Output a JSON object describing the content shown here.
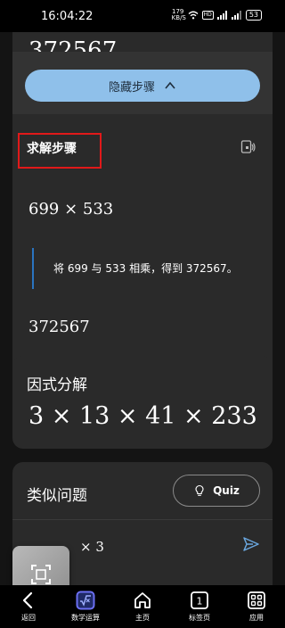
{
  "status_bar": {
    "time": "16:04:22",
    "net_speed_value": "179",
    "net_speed_unit": "KB/S",
    "hd_label": "HD",
    "battery": "53"
  },
  "result": {
    "value_top": "372567",
    "hide_steps_label": "隐藏步骤"
  },
  "steps": {
    "title": "求解步骤",
    "expression": "699 × 533",
    "explanation": "将 699 与 533 相乘，得到 372567。",
    "result": "372567"
  },
  "factor": {
    "title": "因式分解",
    "expression": "3 × 13 × 41 × 233"
  },
  "similar": {
    "title": "类似问题",
    "quiz_label": "Quiz",
    "problem_text": "× 3"
  },
  "nav": [
    {
      "label": "返回",
      "icon": "back-arrow-icon"
    },
    {
      "label": "数学运算",
      "icon": "math-solver-icon"
    },
    {
      "label": "主页",
      "icon": "home-icon"
    },
    {
      "label": "标签页",
      "icon": "tabs-icon",
      "count": "1"
    },
    {
      "label": "应用",
      "icon": "apps-grid-icon"
    }
  ],
  "colors": {
    "accent_button": "#8fc0ea",
    "highlight": "#e1191a",
    "step_line": "#2a74c0",
    "card_bg": "#2a2a2a",
    "active_nav": "#6b6ff2"
  }
}
